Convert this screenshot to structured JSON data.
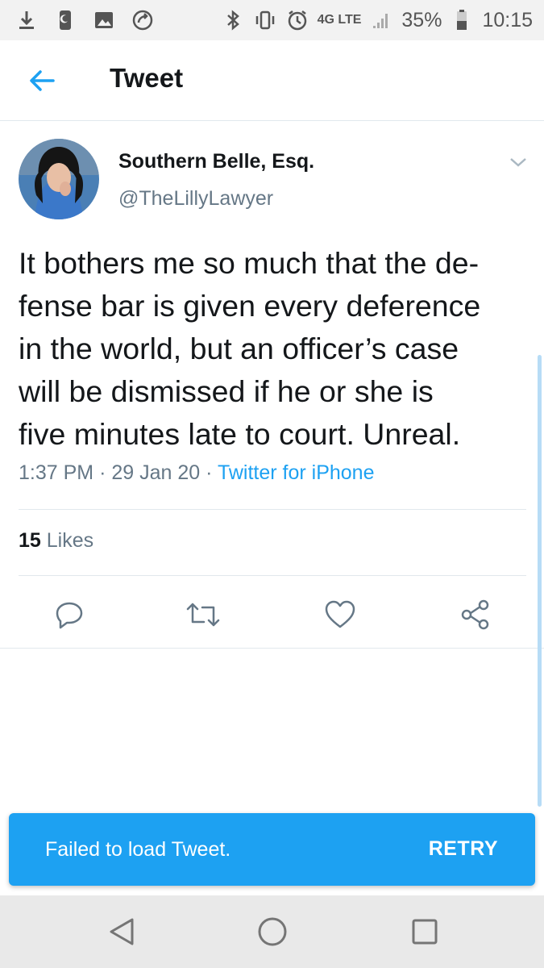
{
  "status_bar": {
    "icons": [
      "download-icon",
      "phone-icon",
      "image-icon",
      "sync-icon"
    ],
    "right_icons": [
      "bluetooth-icon",
      "vibrate-icon",
      "alarm-icon"
    ],
    "network": "4G LTE",
    "battery": "35%",
    "time": "10:15"
  },
  "app_bar": {
    "title": "Tweet"
  },
  "tweet": {
    "author_name": "Southern Belle, Esq.",
    "author_handle": "@TheLillyLawyer",
    "text": "It bothers me so much that the de-\nfense bar is given every deference\nin the world, but an officer’s case\nwill be dismissed if he or she is\nfive minutes late to court. Unreal.",
    "time": "1:37 PM",
    "date": "29 Jan 20",
    "separator": "·",
    "source": "Twitter for iPhone",
    "likes_count": "15",
    "likes_label": "Likes"
  },
  "actions": [
    "reply-icon",
    "retweet-icon",
    "like-icon",
    "share-icon"
  ],
  "snackbar": {
    "message": "Failed to load Tweet.",
    "action": "RETRY"
  },
  "nav_bar": [
    "back-icon",
    "home-icon",
    "recents-icon"
  ],
  "colors": {
    "accent": "#1da1f2",
    "text": "#14171a",
    "secondary": "#657786"
  }
}
